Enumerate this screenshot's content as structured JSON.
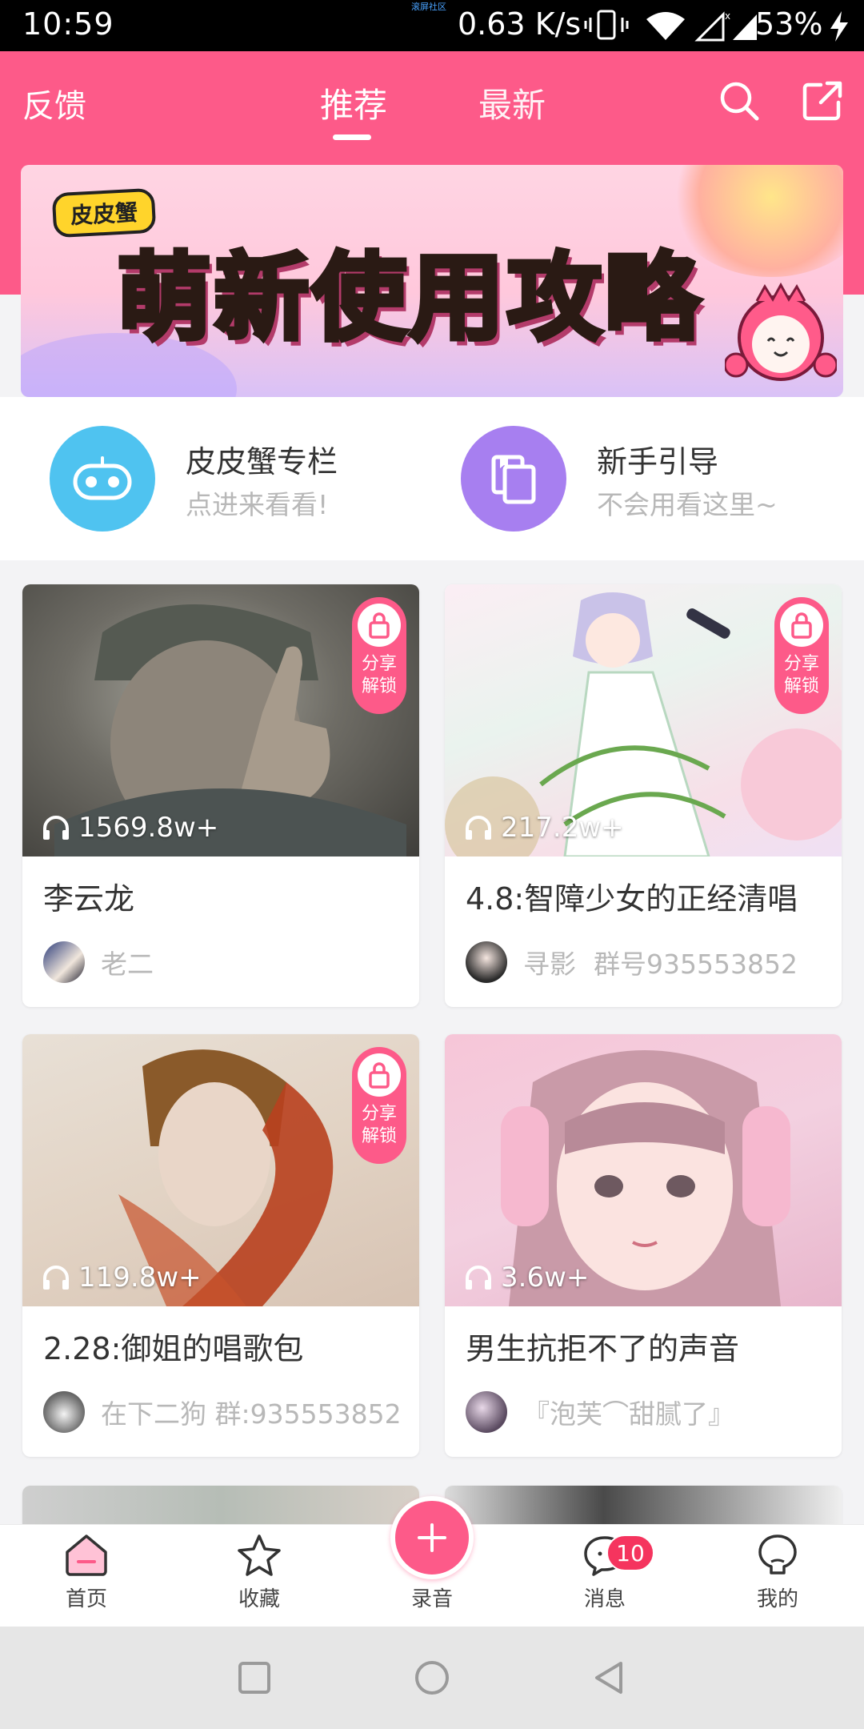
{
  "status_bar": {
    "time": "10:59",
    "carrier_tiny": "滚屏社区",
    "net_speed": "0.63 K/s",
    "battery": "53%"
  },
  "header": {
    "feedback": "反馈",
    "tabs": [
      {
        "label": "推荐",
        "active": true
      },
      {
        "label": "最新",
        "active": false
      }
    ]
  },
  "banner": {
    "badge": "皮皮蟹",
    "title": "萌新使用攻略"
  },
  "quick_entries": [
    {
      "title": "皮皮蟹专栏",
      "subtitle": "点进来看看!",
      "icon": "gamepad-icon",
      "color": "#4fc3f0"
    },
    {
      "title": "新手引导",
      "subtitle": "不会用看这里~",
      "icon": "copy-icon",
      "color": "#a77ff0"
    }
  ],
  "cards": [
    {
      "title": "李云龙",
      "plays": "1569.8w+",
      "author": "老二",
      "group": "",
      "locked": true,
      "lock_text": "分享\n解锁"
    },
    {
      "title": "4.8:智障少女的正经清唱",
      "plays": "217.2w+",
      "author": "寻影",
      "group": "群号935553852",
      "locked": true,
      "lock_text": "分享\n解锁"
    },
    {
      "title": "2.28:御姐的唱歌包",
      "plays": "119.8w+",
      "author": "在下二狗 群:935553852",
      "group": "",
      "locked": true,
      "lock_text": "分享\n解锁"
    },
    {
      "title": "男生抗拒不了的声音",
      "plays": "3.6w+",
      "author": "『泡芙⌒甜腻了』",
      "group": "",
      "locked": false,
      "lock_text": ""
    }
  ],
  "lock": {
    "line1": "分享",
    "line2": "解锁"
  },
  "bottom_nav": {
    "home": "首页",
    "favorites": "收藏",
    "record": "录音",
    "messages": "消息",
    "messages_badge": "10",
    "me": "我的"
  },
  "colors": {
    "accent": "#fd5a89",
    "badge": "#f5345e"
  }
}
